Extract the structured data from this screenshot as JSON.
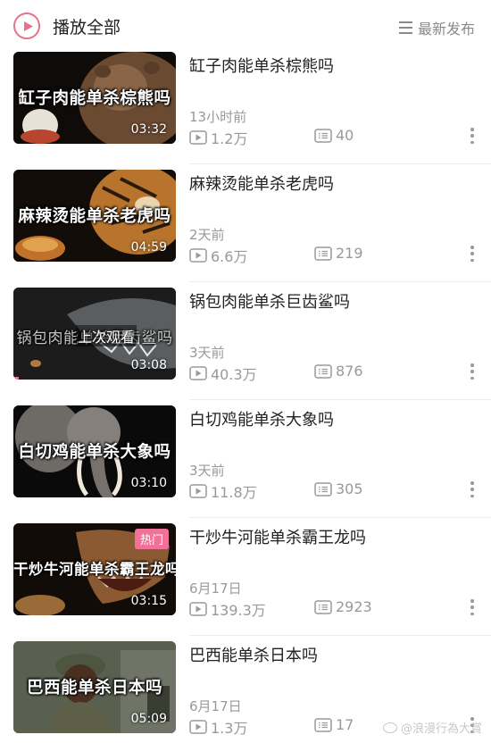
{
  "header": {
    "play_all_label": "播放全部",
    "sort_label": "最新发布"
  },
  "videos": [
    {
      "title": "缸子肉能单杀棕熊吗",
      "thumb_caption": "缸子肉能单杀棕熊吗",
      "duration": "03:32",
      "time_ago": "13小时前",
      "plays": "1.2万",
      "danmaku": "40"
    },
    {
      "title": "麻辣烫能单杀老虎吗",
      "thumb_caption": "麻辣烫能单杀老虎吗",
      "duration": "04:59",
      "time_ago": "2天前",
      "plays": "6.6万",
      "danmaku": "219"
    },
    {
      "title": "锅包肉能单杀巨齿鲨吗",
      "thumb_caption": "锅包肉能单杀巨齿鲨吗",
      "overlay": "上次观看",
      "duration": "03:08",
      "time_ago": "3天前",
      "plays": "40.3万",
      "danmaku": "876"
    },
    {
      "title": "白切鸡能单杀大象吗",
      "thumb_caption": "白切鸡能单杀大象吗",
      "duration": "03:10",
      "time_ago": "3天前",
      "plays": "11.8万",
      "danmaku": "305"
    },
    {
      "title": "干炒牛河能单杀霸王龙吗",
      "thumb_caption": "干炒牛河能单杀霸王龙吗",
      "badge": "热门",
      "duration": "03:15",
      "time_ago": "6月17日",
      "plays": "139.3万",
      "danmaku": "2923"
    },
    {
      "title": "巴西能单杀日本吗",
      "thumb_caption": "巴西能单杀日本吗",
      "duration": "05:09",
      "time_ago": "6月17日",
      "plays": "1.3万",
      "danmaku": "17"
    }
  ],
  "watermark": "@浪漫行為大賞",
  "colors": {
    "accent": "#f2719a",
    "text": "#222222",
    "secondary": "#999999"
  }
}
